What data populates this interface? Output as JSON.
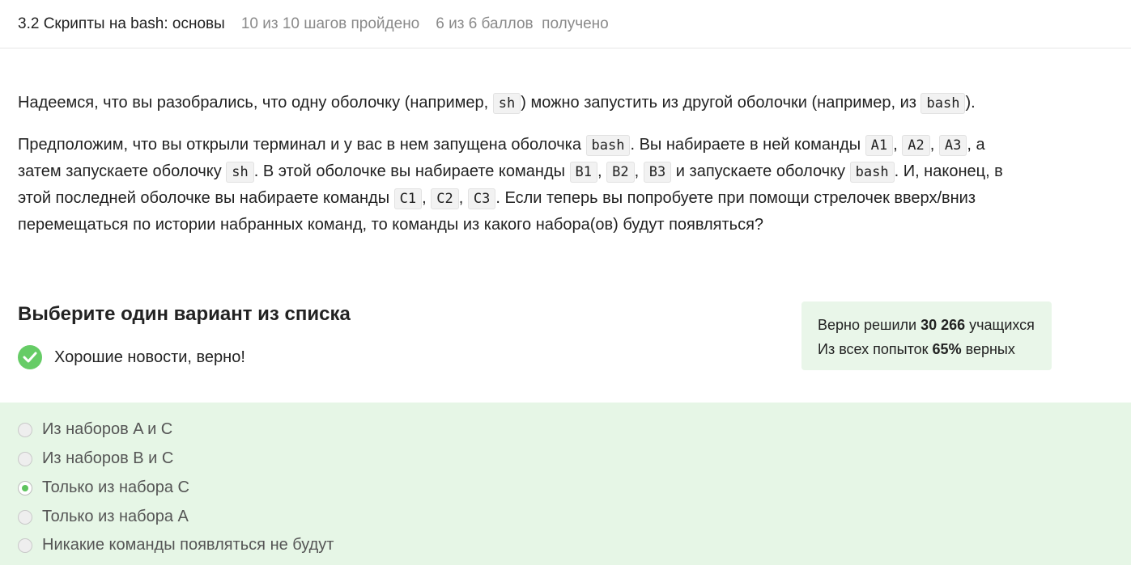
{
  "header": {
    "title": "3.2 Скрипты на bash: основы",
    "steps": "10 из 10 шагов пройдено",
    "points": "6 из 6 баллов  получено"
  },
  "paragraph1": {
    "t1": "Надеемся, что вы разобрались, что одну оболочку (например, ",
    "c1": "sh",
    "t2": ") можно запустить из другой оболочки (например, из ",
    "c2": "bash",
    "t3": ")."
  },
  "paragraph2": {
    "t1": "Предположим, что вы открыли терминал и у вас в нем запущена оболочка ",
    "c_bash1": "bash",
    "t2": ". Вы набираете в ней команды ",
    "a1": "A1",
    "a2": "A2",
    "a3": "A3",
    "t3": ", а затем запускаете оболочку ",
    "c_sh": "sh",
    "t4": ". В этой оболочке вы набираете команды ",
    "b1": "B1",
    "b2": "B2",
    "b3": "B3",
    "t5": " и запускаете оболочку ",
    "c_bash2": "bash",
    "t6": ". И, наконец, в этой последней оболочке вы набираете команды ",
    "c1": "C1",
    "c2": "C2",
    "c3": "C3",
    "t7": ". Если теперь вы попробуете при помощи стрелочек вверх/вниз перемещаться по истории набранных команд, то команды из какого набора(ов) будут появляться?",
    "comma": ", "
  },
  "quiz": {
    "heading": "Выберите один вариант из списка",
    "status": "Хорошие новости, верно!",
    "stats_line1_pre": "Верно решили ",
    "stats_line1_num": "30 266",
    "stats_line1_post": " учащихся",
    "stats_line2_pre": "Из всех попыток ",
    "stats_line2_num": "65%",
    "stats_line2_post": " верных",
    "options": [
      {
        "label": "Из наборов A и C",
        "selected": false
      },
      {
        "label": "Из наборов B и C",
        "selected": false
      },
      {
        "label": "Только из набора C",
        "selected": true
      },
      {
        "label": "Только из набора A",
        "selected": false
      },
      {
        "label": "Никакие команды появляться не будут",
        "selected": false
      }
    ]
  },
  "colors": {
    "accent_green": "#66cc66",
    "options_bg": "#e6f6e6",
    "stats_bg": "#e9f6e9"
  }
}
